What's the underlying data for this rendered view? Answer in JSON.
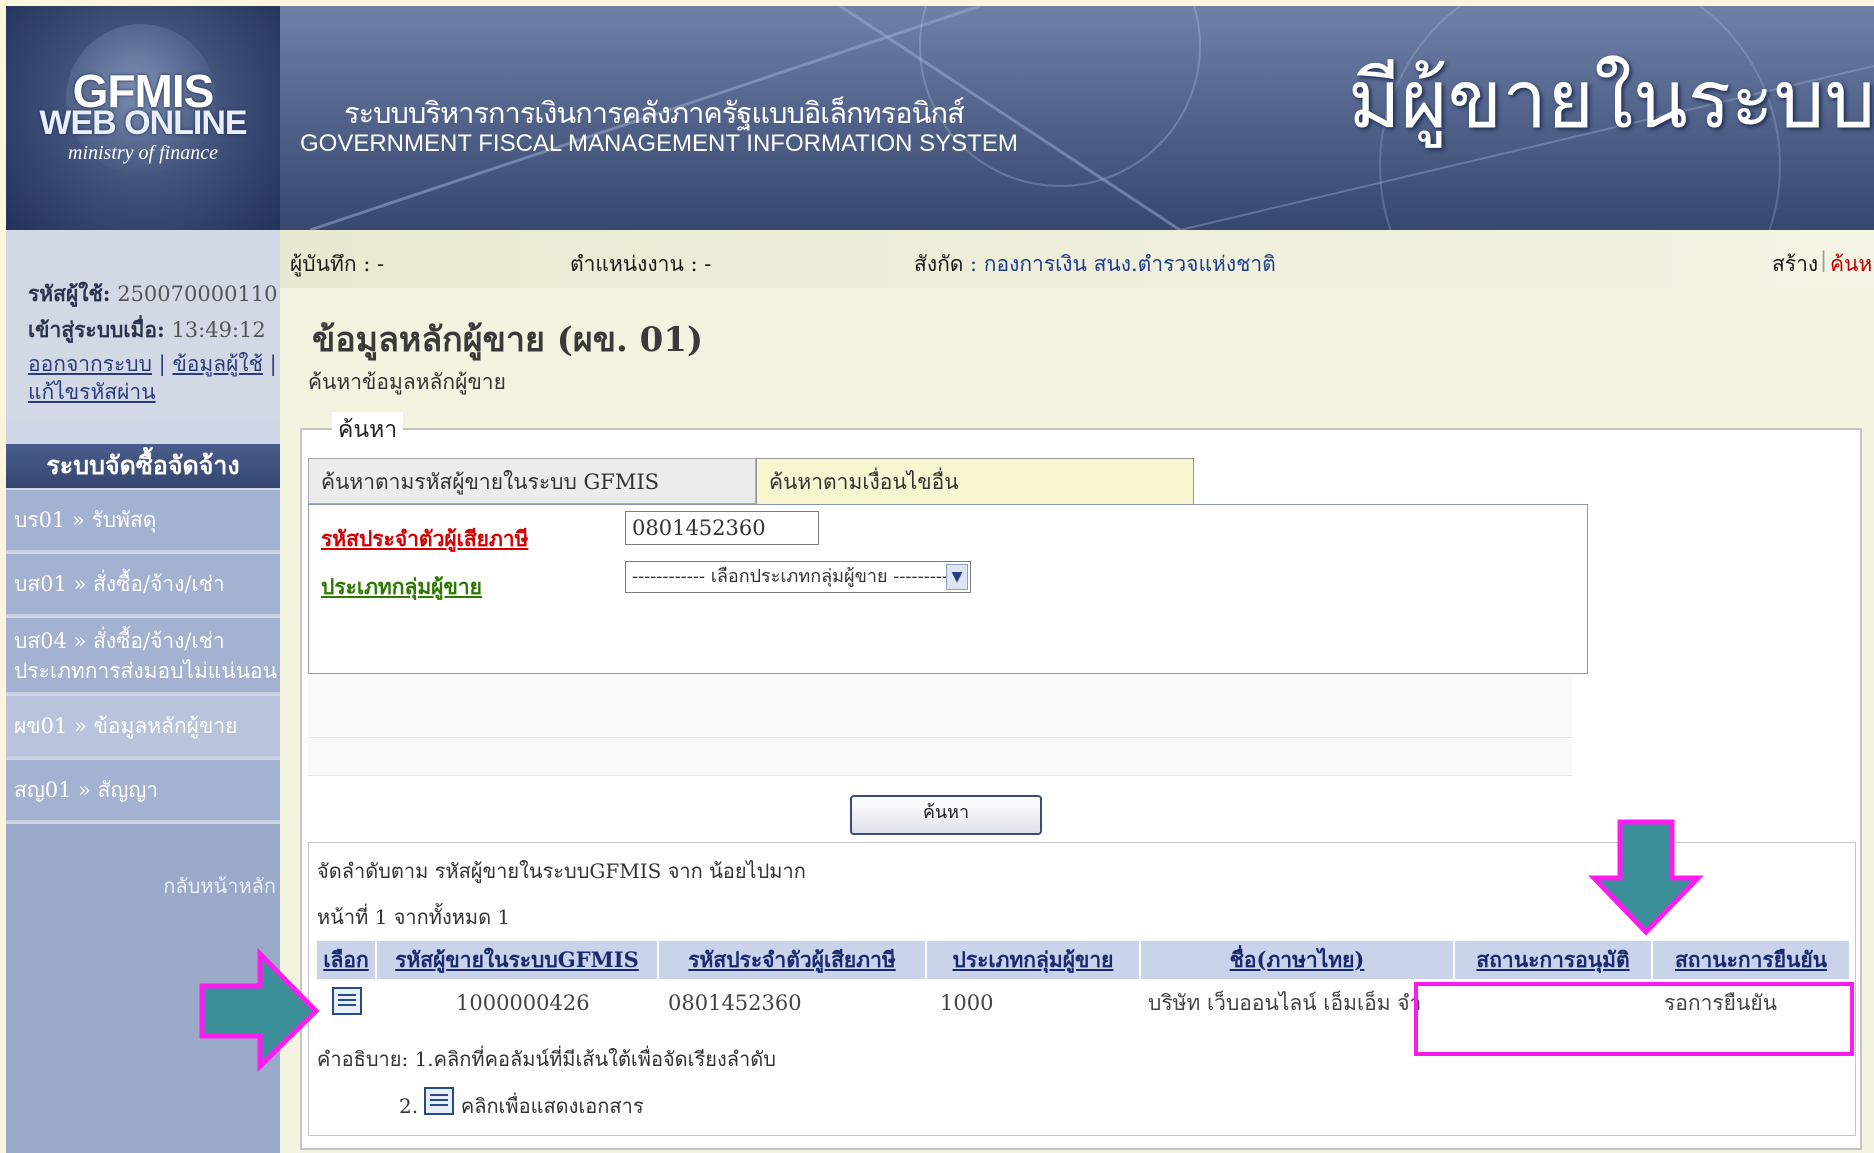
{
  "header": {
    "logo_line1": "GFMIS",
    "logo_line2": "WEB ONLINE",
    "logo_line3": "ministry of finance",
    "system_name_th": "ระบบบริหารการเงินการคลังภาครัฐแบบอิเล็กทรอนิกส์",
    "system_name_en": "GOVERNMENT FISCAL MANAGEMENT INFORMATION SYSTEM"
  },
  "overlay_title": "มีผู้ขายในระบบ",
  "infobar": {
    "recorder_label": "ผู้บันทึก : -",
    "position_label": "ตำแหน่งงาน : -",
    "affiliation_label": "สังกัด",
    "affiliation_value": ": กองการเงิน สนง.ตำรวจแห่งชาติ",
    "create_link": "สร้าง",
    "search_link": "ค้นหา"
  },
  "sidebar": {
    "user_id_label": "รหัสผู้ใช้:",
    "user_id_value": "250070000110",
    "login_label": "เข้าสู่ระบบเมื่อ:",
    "login_time": "13:49:12",
    "logout_link": "ออกจากระบบ",
    "userinfo_link": "ข้อมูลผู้ใช้",
    "change_password_link": "แก้ไขรหัสผ่าน",
    "menu_title": "ระบบจัดซื้อจัดจ้าง",
    "items": [
      {
        "label": "บร01 » รับพัสดุ"
      },
      {
        "label": "บส01 » สั่งซื้อ/จ้าง/เช่า"
      },
      {
        "label": "บส04 » สั่งซื้อ/จ้าง/เช่า ประเภทการส่งมอบไม่แน่นอน"
      },
      {
        "label": "ผข01 » ข้อมูลหลักผู้ขาย"
      },
      {
        "label": "สญ01 » สัญญา"
      }
    ],
    "back_home": "กลับหน้าหลัก"
  },
  "main": {
    "title": "ข้อมูลหลักผู้ขาย (ผข. 01)",
    "subtitle": "ค้นหาข้อมูลหลักผู้ขาย",
    "search_legend": "ค้นหา",
    "tab_gfmis": "ค้นหาตามรหัสผู้ขายในระบบ GFMIS",
    "tab_other": "ค้นหาตามเงื่อนไขอื่น",
    "tax_id_label": "รหัสประจำตัวผู้เสียภาษี",
    "tax_id_value": "0801452360",
    "vendor_group_label": "ประเภทกลุ่มผู้ขาย",
    "vendor_group_selected": "------------ เลือกประเภทกลุ่มผู้ขาย ----------",
    "search_button": "ค้นหา",
    "sort_text": "จัดลำดับตาม รหัสผู้ขายในระบบGFMIS จาก น้อยไปมาก",
    "page_text": "หน้าที่ 1 จากทั้งหมด 1",
    "columns": [
      "เลือก",
      "รหัสผู้ขายในระบบGFMIS",
      "รหัสประจำตัวผู้เสียภาษี",
      "ประเภทกลุ่มผู้ขาย",
      "ชื่อ(ภาษาไทย)",
      "สถานะการอนุมัติ",
      "สถานะการยืนยัน"
    ],
    "rows": [
      {
        "vendor_id": "1000000426",
        "tax_id": "0801452360",
        "group": "1000",
        "name": "บริษัท เว็บออนไลน์ เอ็มเอ็ม จำ",
        "approval": "",
        "confirm": "รอการยืนยัน"
      }
    ],
    "note_prefix": "คำอธิบาย:",
    "note1": "1.คลิกที่คอลัมน์ที่มีเส้นใต้เพื่อจัดเรียงลำดับ",
    "note2_num": "2.",
    "note2": "คลิกเพื่อแสดงเอกสาร"
  },
  "annotation_colors": {
    "arrow": "#3a8f98",
    "outline": "#ff1bf0"
  }
}
